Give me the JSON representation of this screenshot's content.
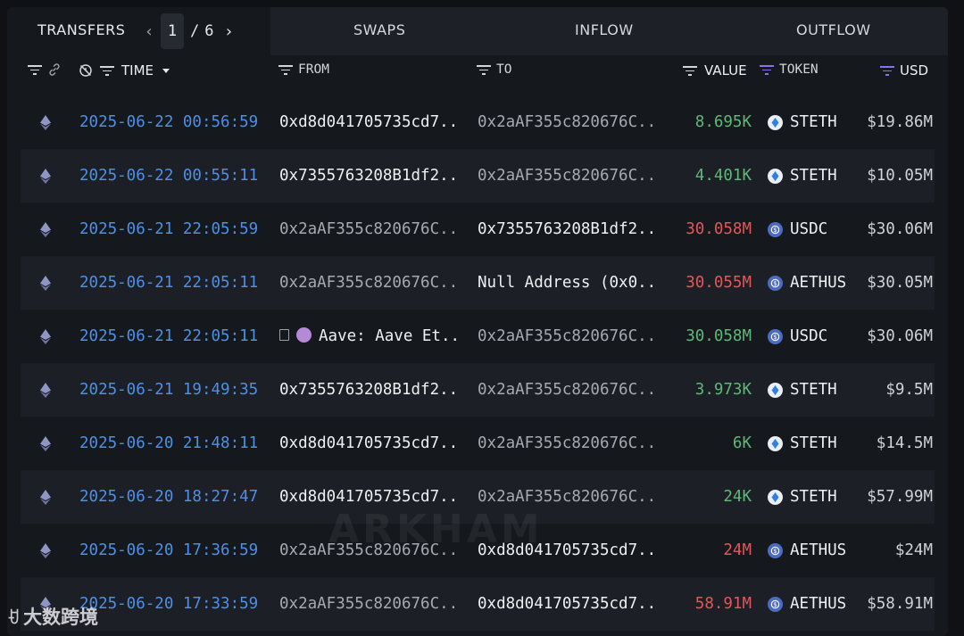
{
  "tabs": {
    "transfers": "TRANSFERS",
    "page_current": "1",
    "page_sep": "/",
    "page_total": "6",
    "swaps": "SWAPS",
    "inflow": "INFLOW",
    "outflow": "OUTFLOW"
  },
  "columns": {
    "time": "TIME",
    "from": "FROM",
    "to": "TO",
    "value": "VALUE",
    "token": "TOKEN",
    "usd": "USD"
  },
  "rows": [
    {
      "time": "2025-06-22 00:56:59",
      "from": "0xd8d041705735cd7...",
      "to": "0x2aAF355c820676C...",
      "value": "8.695K",
      "direction": "in",
      "token": "STETH",
      "token_icon": "steth",
      "usd": "$19.86M"
    },
    {
      "time": "2025-06-22 00:55:11",
      "from": "0x7355763208B1df2...",
      "to": "0x2aAF355c820676C...",
      "value": "4.401K",
      "direction": "in",
      "token": "STETH",
      "token_icon": "steth",
      "usd": "$10.05M"
    },
    {
      "time": "2025-06-21 22:05:59",
      "from": "0x2aAF355c820676C...",
      "to": "0x7355763208B1df2...",
      "value": "30.058M",
      "direction": "out",
      "token": "USDC",
      "token_icon": "usd",
      "usd": "$30.06M"
    },
    {
      "time": "2025-06-21 22:05:11",
      "from": "0x2aAF355c820676C...",
      "to": "Null Address (0x0...",
      "value": "30.055M",
      "direction": "out",
      "token": "AETHUS",
      "token_icon": "usd",
      "usd": "$30.05M"
    },
    {
      "time": "2025-06-21 22:05:11",
      "from": "Aave: Aave Et...",
      "to": "0x2aAF355c820676C...",
      "value": "30.058M",
      "direction": "in",
      "token": "USDC",
      "token_icon": "usd",
      "usd": "$30.06M"
    },
    {
      "time": "2025-06-21 19:49:35",
      "from": "0x7355763208B1df2...",
      "to": "0x2aAF355c820676C...",
      "value": "3.973K",
      "direction": "in",
      "token": "STETH",
      "token_icon": "steth",
      "usd": "$9.5M"
    },
    {
      "time": "2025-06-20 21:48:11",
      "from": "0xd8d041705735cd7...",
      "to": "0x2aAF355c820676C...",
      "value": "6K",
      "direction": "in",
      "token": "STETH",
      "token_icon": "steth",
      "usd": "$14.5M"
    },
    {
      "time": "2025-06-20 18:27:47",
      "from": "0xd8d041705735cd7...",
      "to": "0x2aAF355c820676C...",
      "value": "24K",
      "direction": "in",
      "token": "STETH",
      "token_icon": "steth",
      "usd": "$57.99M"
    },
    {
      "time": "2025-06-20 17:36:59",
      "from": "0x2aAF355c820676C...",
      "to": "0xd8d041705735cd7...",
      "value": "24M",
      "direction": "out",
      "token": "AETHUS",
      "token_icon": "usd",
      "usd": "$24M"
    },
    {
      "time": "2025-06-20 17:33:59",
      "from": "0x2aAF355c820676C...",
      "to": "0xd8d041705735cd7...",
      "value": "58.91M",
      "direction": "out",
      "token": "AETHUS",
      "token_icon": "usd",
      "usd": "$58.91M"
    }
  ],
  "watermark": "ARKHAM",
  "corner_watermark": "大数跨境",
  "colors": {
    "time": "#4f8fe6",
    "inflow": "#5fb877",
    "outflow": "#e2575a",
    "accent_filter": "#8c6ff0"
  }
}
